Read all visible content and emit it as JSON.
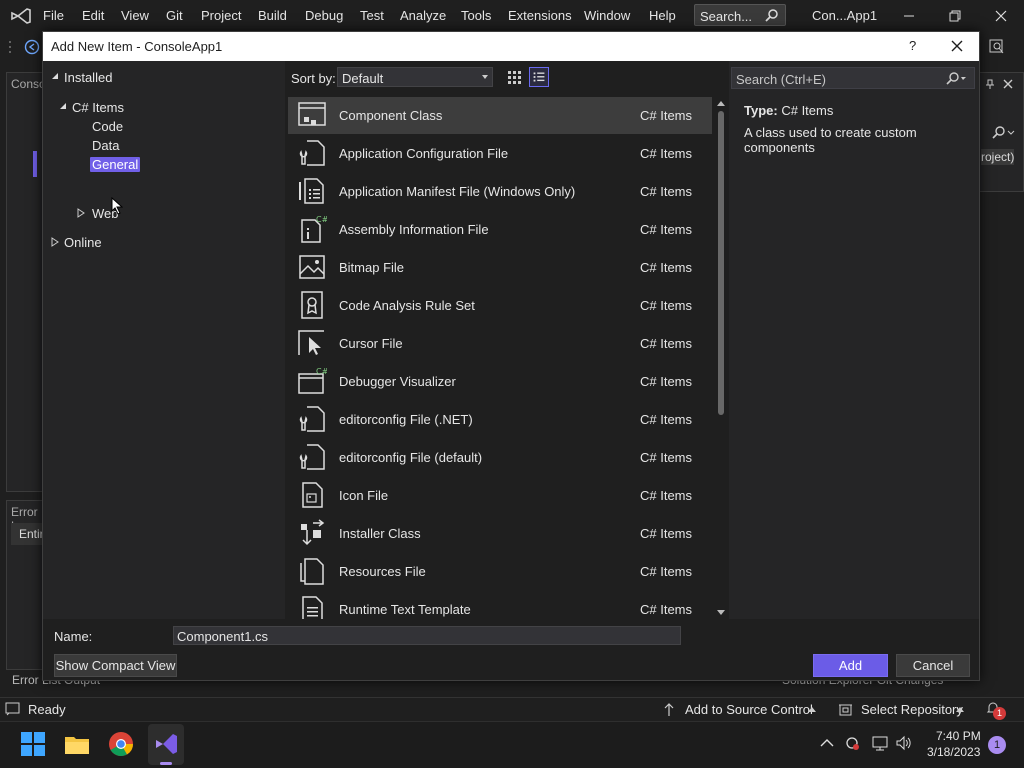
{
  "app": {
    "menu": [
      "File",
      "Edit",
      "View",
      "Git",
      "Project",
      "Build",
      "Debug",
      "Test",
      "Analyze",
      "Tools",
      "Extensions",
      "Window",
      "Help"
    ],
    "search_placeholder": "Search...",
    "title": "Con...App1",
    "accent": "#7160e8"
  },
  "background": {
    "tab_fragment": "Conso",
    "error_tab_fragment": "Error L",
    "entire_fragment": "Entir",
    "project_fragment": "roject)",
    "bottom_left_tabs": "Error List   Output",
    "bottom_right_tabs": "Solution Explorer   Git Changes"
  },
  "dialog": {
    "title": "Add New Item - ConsoleApp1",
    "help_label": "?",
    "tree": {
      "installed": "Installed",
      "csharp_items": "C# Items",
      "code": "Code",
      "data": "Data",
      "general": "General",
      "web": "Web",
      "online": "Online"
    },
    "sort_by_label": "Sort by:",
    "sort_value": "Default",
    "search_placeholder": "Search (Ctrl+E)",
    "items": [
      {
        "name": "Component Class",
        "category": "C# Items",
        "icon": "component-class-icon"
      },
      {
        "name": "Application Configuration File",
        "category": "C# Items",
        "icon": "config-file-icon"
      },
      {
        "name": "Application Manifest File (Windows Only)",
        "category": "C# Items",
        "icon": "manifest-file-icon"
      },
      {
        "name": "Assembly Information File",
        "category": "C# Items",
        "icon": "assembly-info-icon"
      },
      {
        "name": "Bitmap File",
        "category": "C# Items",
        "icon": "bitmap-file-icon"
      },
      {
        "name": "Code Analysis Rule Set",
        "category": "C# Items",
        "icon": "rule-set-icon"
      },
      {
        "name": "Cursor File",
        "category": "C# Items",
        "icon": "cursor-file-icon"
      },
      {
        "name": "Debugger Visualizer",
        "category": "C# Items",
        "icon": "debugger-visualizer-icon"
      },
      {
        "name": "editorconfig File (.NET)",
        "category": "C# Items",
        "icon": "editorconfig-icon"
      },
      {
        "name": "editorconfig File (default)",
        "category": "C# Items",
        "icon": "editorconfig-icon"
      },
      {
        "name": "Icon File",
        "category": "C# Items",
        "icon": "icon-file-icon"
      },
      {
        "name": "Installer Class",
        "category": "C# Items",
        "icon": "installer-class-icon"
      },
      {
        "name": "Resources File",
        "category": "C# Items",
        "icon": "resources-file-icon"
      },
      {
        "name": "Runtime Text Template",
        "category": "C# Items",
        "icon": "text-template-icon"
      }
    ],
    "detail": {
      "type_label": "Type:",
      "type_value": "C# Items",
      "description": "A class used to create custom components"
    },
    "name_label": "Name:",
    "name_value": "Component1.cs",
    "compact_view_label": "Show Compact View",
    "add_label": "Add",
    "cancel_label": "Cancel"
  },
  "statusbar": {
    "ready": "Ready",
    "add_to_source_control": "Add to Source Control",
    "select_repository": "Select Repository",
    "notification_count": "1"
  },
  "taskbar": {
    "time": "7:40 PM",
    "date": "3/18/2023",
    "notification_count": "1"
  }
}
